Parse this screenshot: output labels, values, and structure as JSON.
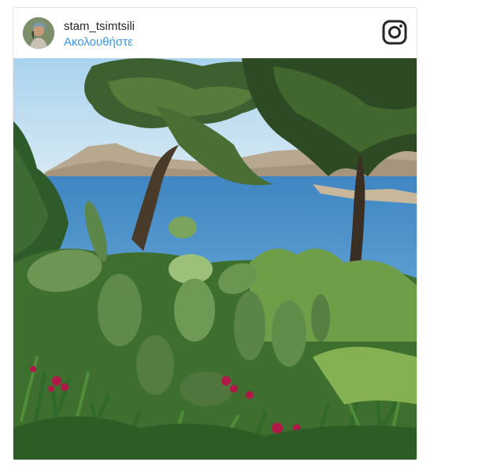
{
  "post": {
    "username": "stam_tsimtsili",
    "follow_label": "Ακολουθήστε"
  },
  "icons": {
    "platform": "instagram-icon",
    "avatar": "avatar"
  },
  "colors": {
    "follow_link": "#3897f0",
    "username": "#262626",
    "border": "#e3e3e3"
  }
}
